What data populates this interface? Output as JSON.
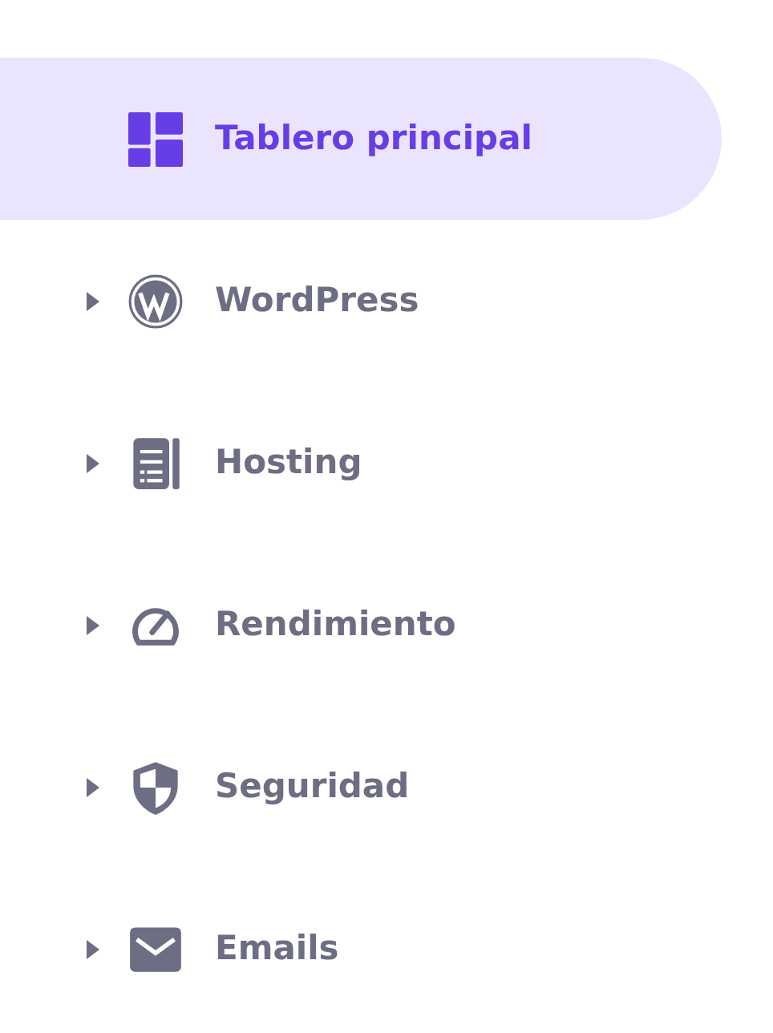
{
  "sidebar": {
    "items": [
      {
        "label": "Tablero principal",
        "selected": true,
        "has_submenu": false
      },
      {
        "label": "WordPress",
        "selected": false,
        "has_submenu": true
      },
      {
        "label": "Hosting",
        "selected": false,
        "has_submenu": true
      },
      {
        "label": "Rendimiento",
        "selected": false,
        "has_submenu": true
      },
      {
        "label": "Seguridad",
        "selected": false,
        "has_submenu": true
      },
      {
        "label": "Emails",
        "selected": false,
        "has_submenu": true
      }
    ]
  }
}
